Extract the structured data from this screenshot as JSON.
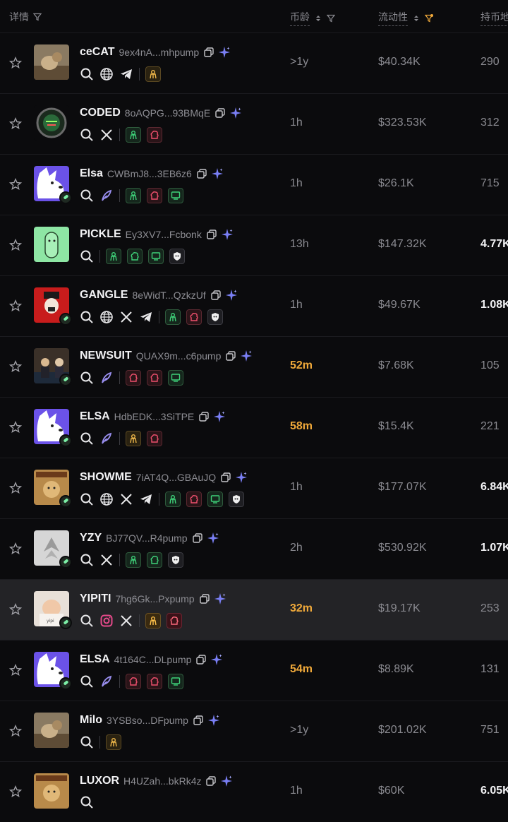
{
  "header": {
    "details": "详情",
    "age": "币龄",
    "liquidity": "流动性",
    "holders": "持币地"
  },
  "colors": {
    "accent_orange": "#f0a93a",
    "green": "#3fd37a",
    "red": "#f0506e"
  },
  "rows": [
    {
      "symbol": "ceCAT",
      "address": "9ex4nA...mhpump",
      "age": ">1y",
      "age_highlight": false,
      "liquidity": "$40.34K",
      "holders": "290",
      "holders_bright": false,
      "badge": false,
      "highlight": false,
      "avatar": "cat-photo",
      "socials": [
        "search",
        "web",
        "telegram"
      ],
      "tags": [
        "yellow"
      ]
    },
    {
      "symbol": "CODED",
      "address": "8oAQPG...93BMqE",
      "age": "1h",
      "age_highlight": false,
      "liquidity": "$323.53K",
      "holders": "312",
      "holders_bright": false,
      "badge": false,
      "highlight": false,
      "avatar": "green-circle",
      "socials": [
        "search",
        "x"
      ],
      "tags": [
        "green",
        "red"
      ]
    },
    {
      "symbol": "Elsa",
      "address": "CWBmJ8...3EB6z6",
      "age": "1h",
      "age_highlight": false,
      "liquidity": "$26.1K",
      "holders": "715",
      "holders_bright": false,
      "badge": true,
      "highlight": false,
      "avatar": "white-cartoon",
      "socials": [
        "search",
        "feather"
      ],
      "tags": [
        "green",
        "red",
        "green"
      ]
    },
    {
      "symbol": "PICKLE",
      "address": "Ey3XV7...Fcbonk",
      "age": "13h",
      "age_highlight": false,
      "liquidity": "$147.32K",
      "holders": "4.77K",
      "holders_bright": true,
      "badge": false,
      "highlight": false,
      "avatar": "pickle",
      "socials": [
        "search"
      ],
      "tags": [
        "green",
        "green",
        "green",
        "white"
      ]
    },
    {
      "symbol": "GANGLE",
      "address": "8eWidT...QzkzUf",
      "age": "1h",
      "age_highlight": false,
      "liquidity": "$49.67K",
      "holders": "1.08K",
      "holders_bright": true,
      "badge": true,
      "highlight": false,
      "avatar": "red-clown",
      "socials": [
        "search",
        "web",
        "x",
        "telegram"
      ],
      "tags": [
        "green",
        "red",
        "white"
      ]
    },
    {
      "symbol": "NEWSUIT",
      "address": "QUAX9m...c6pump",
      "age": "52m",
      "age_highlight": true,
      "liquidity": "$7.68K",
      "holders": "105",
      "holders_bright": false,
      "badge": true,
      "highlight": false,
      "avatar": "people-photo",
      "socials": [
        "search",
        "feather"
      ],
      "tags": [
        "red",
        "red",
        "green"
      ]
    },
    {
      "symbol": "ELSA",
      "address": "HdbEDK...3SiTPE",
      "age": "58m",
      "age_highlight": true,
      "liquidity": "$15.4K",
      "holders": "221",
      "holders_bright": false,
      "badge": true,
      "highlight": false,
      "avatar": "white-cartoon",
      "socials": [
        "search",
        "feather"
      ],
      "tags": [
        "yellow",
        "red"
      ]
    },
    {
      "symbol": "SHOWME",
      "address": "7iAT4Q...GBAuJQ",
      "age": "1h",
      "age_highlight": false,
      "liquidity": "$177.07K",
      "holders": "6.84K",
      "holders_bright": true,
      "badge": true,
      "highlight": false,
      "avatar": "meme-poster",
      "socials": [
        "search",
        "web",
        "x",
        "telegram"
      ],
      "tags": [
        "green",
        "red",
        "green",
        "white"
      ]
    },
    {
      "symbol": "YZY",
      "address": "BJ77QV...R4pump",
      "age": "2h",
      "age_highlight": false,
      "liquidity": "$530.92K",
      "holders": "1.07K",
      "holders_bright": true,
      "badge": true,
      "highlight": false,
      "avatar": "gray-logo",
      "socials": [
        "search",
        "x"
      ],
      "tags": [
        "green",
        "green",
        "white"
      ]
    },
    {
      "symbol": "YIPITI",
      "address": "7hg6Gk...Pxpump",
      "age": "32m",
      "age_highlight": true,
      "liquidity": "$19.17K",
      "holders": "253",
      "holders_bright": false,
      "badge": true,
      "highlight": true,
      "avatar": "baby-photo",
      "socials": [
        "search",
        "instagram",
        "x"
      ],
      "tags": [
        "yellowsolid",
        "redsolid"
      ]
    },
    {
      "symbol": "ELSA",
      "address": "4t164C...DLpump",
      "age": "54m",
      "age_highlight": true,
      "liquidity": "$8.89K",
      "holders": "131",
      "holders_bright": false,
      "badge": true,
      "highlight": false,
      "avatar": "white-cartoon",
      "socials": [
        "search",
        "feather"
      ],
      "tags": [
        "red",
        "red",
        "green"
      ]
    },
    {
      "symbol": "Milo",
      "address": "3YSBso...DFpump",
      "age": ">1y",
      "age_highlight": false,
      "liquidity": "$201.02K",
      "holders": "751",
      "holders_bright": false,
      "badge": false,
      "highlight": false,
      "avatar": "cat-photo",
      "socials": [
        "search"
      ],
      "tags": [
        "yellow"
      ]
    },
    {
      "symbol": "LUXOR",
      "address": "H4UZah...bkRk4z",
      "age": "1h",
      "age_highlight": false,
      "liquidity": "$60K",
      "holders": "6.05K",
      "holders_bright": true,
      "badge": false,
      "highlight": false,
      "avatar": "meme-poster",
      "socials": [
        "search"
      ],
      "tags": []
    }
  ]
}
